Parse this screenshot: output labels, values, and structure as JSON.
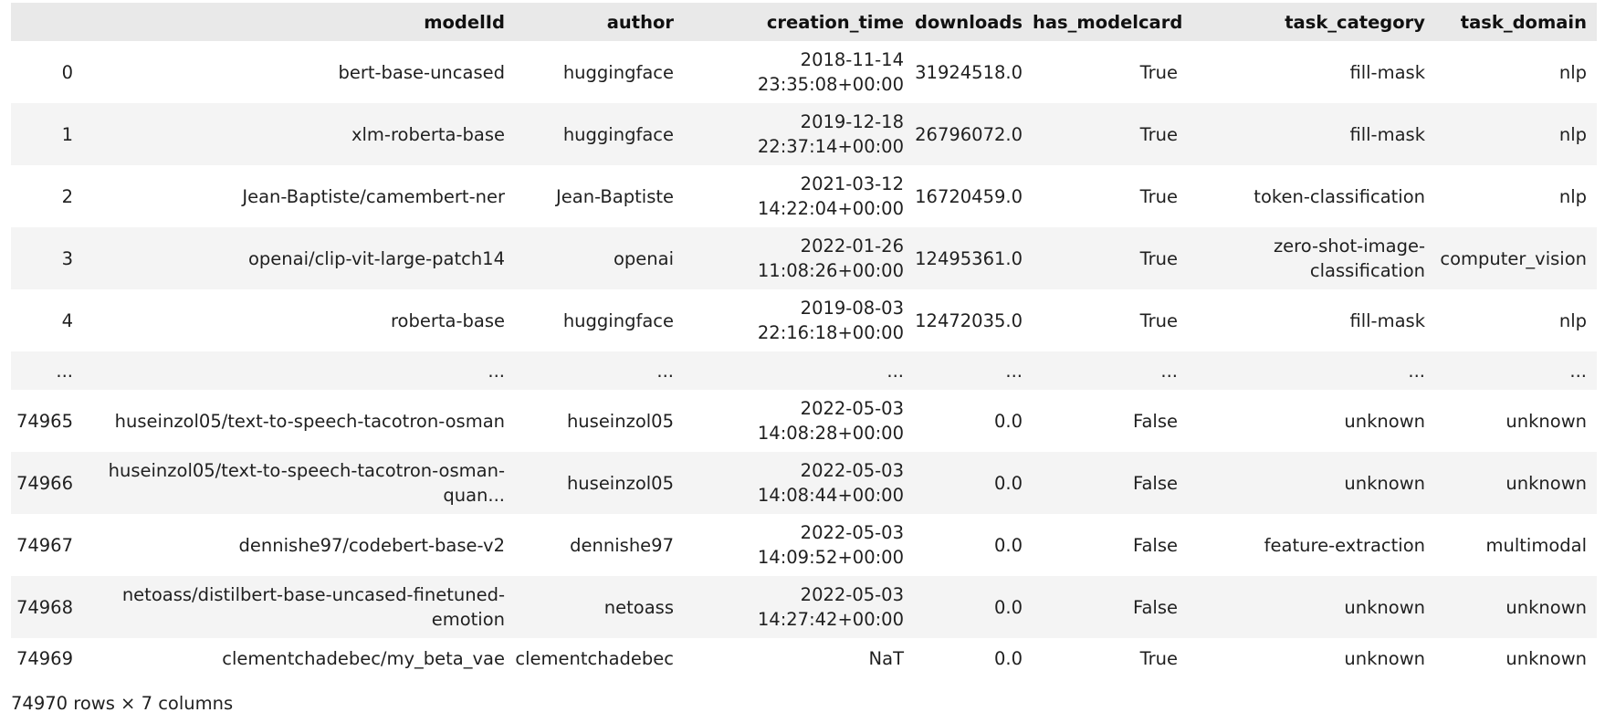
{
  "table": {
    "columns": [
      "",
      "modelId",
      "author",
      "creation_time",
      "downloads",
      "has_modelcard",
      "task_category",
      "task_domain"
    ],
    "rows": [
      {
        "index": "0",
        "modelId": "bert-base-uncased",
        "author": "huggingface",
        "creation_time": "2018-11-14 23:35:08+00:00",
        "downloads": "31924518.0",
        "has_modelcard": "True",
        "task_category": "fill-mask",
        "task_domain": "nlp"
      },
      {
        "index": "1",
        "modelId": "xlm-roberta-base",
        "author": "huggingface",
        "creation_time": "2019-12-18 22:37:14+00:00",
        "downloads": "26796072.0",
        "has_modelcard": "True",
        "task_category": "fill-mask",
        "task_domain": "nlp"
      },
      {
        "index": "2",
        "modelId": "Jean-Baptiste/camembert-ner",
        "author": "Jean-Baptiste",
        "creation_time": "2021-03-12 14:22:04+00:00",
        "downloads": "16720459.0",
        "has_modelcard": "True",
        "task_category": "token-classification",
        "task_domain": "nlp"
      },
      {
        "index": "3",
        "modelId": "openai/clip-vit-large-patch14",
        "author": "openai",
        "creation_time": "2022-01-26 11:08:26+00:00",
        "downloads": "12495361.0",
        "has_modelcard": "True",
        "task_category": "zero-shot-image-classification",
        "task_domain": "computer_vision"
      },
      {
        "index": "4",
        "modelId": "roberta-base",
        "author": "huggingface",
        "creation_time": "2019-08-03 22:16:18+00:00",
        "downloads": "12472035.0",
        "has_modelcard": "True",
        "task_category": "fill-mask",
        "task_domain": "nlp"
      },
      {
        "index": "...",
        "modelId": "...",
        "author": "...",
        "creation_time": "...",
        "downloads": "...",
        "has_modelcard": "...",
        "task_category": "...",
        "task_domain": "..."
      },
      {
        "index": "74965",
        "modelId": "huseinzol05/text-to-speech-tacotron-osman",
        "author": "huseinzol05",
        "creation_time": "2022-05-03 14:08:28+00:00",
        "downloads": "0.0",
        "has_modelcard": "False",
        "task_category": "unknown",
        "task_domain": "unknown"
      },
      {
        "index": "74966",
        "modelId": "huseinzol05/text-to-speech-tacotron-osman-quan...",
        "author": "huseinzol05",
        "creation_time": "2022-05-03 14:08:44+00:00",
        "downloads": "0.0",
        "has_modelcard": "False",
        "task_category": "unknown",
        "task_domain": "unknown"
      },
      {
        "index": "74967",
        "modelId": "dennishe97/codebert-base-v2",
        "author": "dennishe97",
        "creation_time": "2022-05-03 14:09:52+00:00",
        "downloads": "0.0",
        "has_modelcard": "False",
        "task_category": "feature-extraction",
        "task_domain": "multimodal"
      },
      {
        "index": "74968",
        "modelId": "netoass/distilbert-base-uncased-finetuned-emotion",
        "author": "netoass",
        "creation_time": "2022-05-03 14:27:42+00:00",
        "downloads": "0.0",
        "has_modelcard": "False",
        "task_category": "unknown",
        "task_domain": "unknown"
      },
      {
        "index": "74969",
        "modelId": "clementchadebec/my_beta_vae",
        "author": "clementchadebec",
        "creation_time": "NaT",
        "downloads": "0.0",
        "has_modelcard": "True",
        "task_category": "unknown",
        "task_domain": "unknown"
      }
    ]
  },
  "shape_note": "74970 rows × 7 columns"
}
